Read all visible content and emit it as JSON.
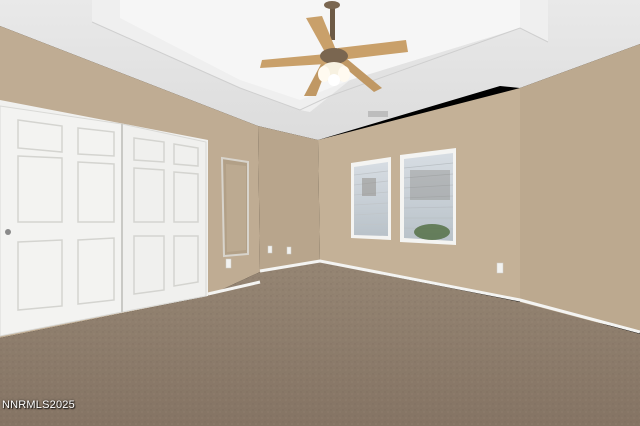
{
  "photo": {
    "subject": "empty-bedroom",
    "watermark": "NNRMLS2025"
  },
  "colors": {
    "wall_left": "#bfac93",
    "wall_back": "#c4b197",
    "wall_right": "#bca98f",
    "ceiling": "#e6e6e6",
    "carpet": "#8b7b6c",
    "trim": "#f4f4f2",
    "door": "#f2f2f0",
    "fan_blade": "#c9a06a"
  }
}
